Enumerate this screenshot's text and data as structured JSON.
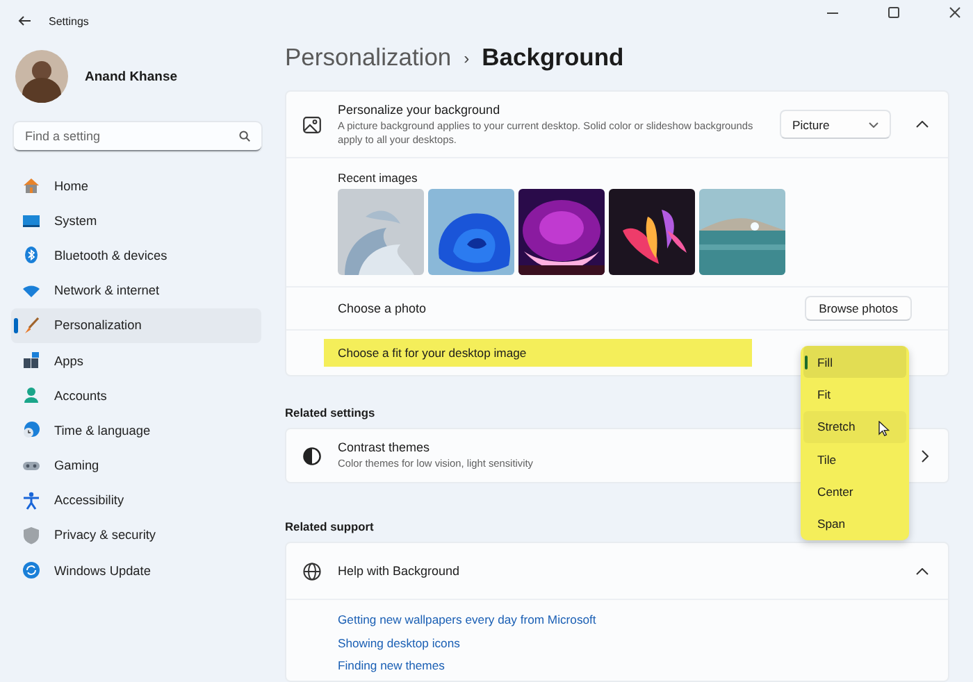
{
  "window": {
    "title": "Settings"
  },
  "profile": {
    "name": "Anand Khanse"
  },
  "search": {
    "placeholder": "Find a setting"
  },
  "nav": [
    {
      "label": "Home",
      "selected": false
    },
    {
      "label": "System",
      "selected": false
    },
    {
      "label": "Bluetooth & devices",
      "selected": false
    },
    {
      "label": "Network & internet",
      "selected": false
    },
    {
      "label": "Personalization",
      "selected": true
    },
    {
      "label": "Apps",
      "selected": false
    },
    {
      "label": "Accounts",
      "selected": false
    },
    {
      "label": "Time & language",
      "selected": false
    },
    {
      "label": "Gaming",
      "selected": false
    },
    {
      "label": "Accessibility",
      "selected": false
    },
    {
      "label": "Privacy & security",
      "selected": false
    },
    {
      "label": "Windows Update",
      "selected": false
    }
  ],
  "breadcrumb": {
    "parent": "Personalization",
    "separator": "›",
    "current": "Background"
  },
  "background_card": {
    "title": "Personalize your background",
    "description": "A picture background applies to your current desktop. Solid color or slideshow backgrounds apply to all your desktops.",
    "dropdown": {
      "value": "Picture"
    },
    "expanded": true,
    "recent_images": {
      "label": "Recent images"
    },
    "choose_photo": {
      "label": "Choose a photo",
      "button": "Browse photos"
    },
    "fit": {
      "label": "Choose a fit for your desktop image",
      "highlighted": true,
      "menu": {
        "highlighted": true,
        "options": [
          {
            "label": "Fill",
            "selected": true,
            "hovered": false
          },
          {
            "label": "Fit",
            "selected": false,
            "hovered": false
          },
          {
            "label": "Stretch",
            "selected": false,
            "hovered": true
          },
          {
            "label": "Tile",
            "selected": false,
            "hovered": false
          },
          {
            "label": "Center",
            "selected": false,
            "hovered": false
          },
          {
            "label": "Span",
            "selected": false,
            "hovered": false
          }
        ]
      }
    }
  },
  "related_settings": {
    "heading": "Related settings",
    "items": [
      {
        "title": "Contrast themes",
        "description": "Color themes for low vision, light sensitivity"
      }
    ]
  },
  "related_support": {
    "heading": "Related support",
    "help": {
      "title": "Help with Background",
      "expanded": true,
      "links": [
        "Getting new wallpapers every day from Microsoft",
        "Showing desktop icons",
        "Finding new themes"
      ]
    }
  }
}
